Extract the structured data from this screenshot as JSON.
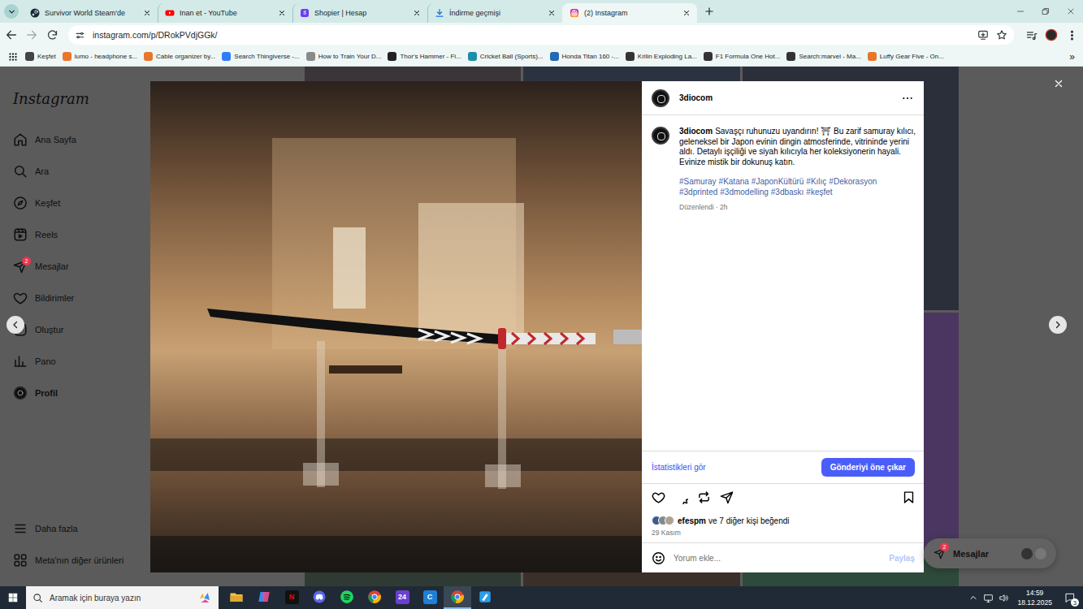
{
  "browser": {
    "tabs": [
      {
        "label": "Survivor World Steam'de",
        "selected": false,
        "kind": "steam"
      },
      {
        "label": "Inan et - YouTube",
        "selected": false,
        "kind": "youtube"
      },
      {
        "label": "Shopier | Hesap",
        "selected": false,
        "kind": "shopier"
      },
      {
        "label": "İndirme geçmişi",
        "selected": false,
        "kind": "download"
      },
      {
        "label": "(2) Instagram",
        "selected": true,
        "kind": "instagram"
      }
    ],
    "url": "instagram.com/p/DRokPVdjGGk/",
    "bookmarked": false,
    "bookmarks": [
      {
        "label": "Keşfet",
        "color": "#444444"
      },
      {
        "label": "lumo - headphone s...",
        "color": "#e8762b"
      },
      {
        "label": "Cable organizer by...",
        "color": "#e8762b"
      },
      {
        "label": "Search Thingiverse -...",
        "color": "#2f7df6"
      },
      {
        "label": "How to Train Your D...",
        "color": "#8a8a8a"
      },
      {
        "label": "Thor's Hammer - Fi...",
        "color": "#222222"
      },
      {
        "label": "Cricket Ball (Sports)...",
        "color": "#1c8fa8"
      },
      {
        "label": "Honda Titan 160 -...",
        "color": "#2469b3"
      },
      {
        "label": "Krilin Exploding La...",
        "color": "#333333"
      },
      {
        "label": "F1 Formula One Hot...",
        "color": "#333333"
      },
      {
        "label": "Search:marvel - Ma...",
        "color": "#333333"
      },
      {
        "label": "Luffy Gear Five - On...",
        "color": "#e8762b"
      }
    ],
    "bookmarks_more": "»"
  },
  "instagram": {
    "logo": "Instagram",
    "nav": [
      {
        "label": "Ana Sayfa",
        "kind": "home",
        "selected": false
      },
      {
        "label": "Ara",
        "kind": "search",
        "selected": false
      },
      {
        "label": "Keşfet",
        "kind": "explore",
        "selected": false
      },
      {
        "label": "Reels",
        "kind": "reels",
        "selected": false
      },
      {
        "label": "Mesajlar",
        "kind": "messages",
        "selected": false,
        "badge": "2"
      },
      {
        "label": "Bildirimler",
        "kind": "heart",
        "selected": false
      },
      {
        "label": "Oluştur",
        "kind": "create",
        "selected": false
      },
      {
        "label": "Pano",
        "kind": "dashboard",
        "selected": false
      },
      {
        "label": "Profil",
        "kind": "profile",
        "selected": true
      }
    ],
    "nav_bottom": [
      {
        "label": "Daha fazla",
        "kind": "menu"
      },
      {
        "label": "Meta'nın diğer ürünleri",
        "kind": "meta"
      }
    ]
  },
  "post": {
    "author": "3diocom",
    "caption_author": "3diocom",
    "caption": "Savaşçı ruhunuzu uyandırın! ⛩ Bu zarif samuray kılıcı, geleneksel bir Japon evinin dingin atmosferinde, vitrininde yerini aldı. Detaylı işçiliği ve siyah kılıcıyla her koleksiyonerin hayali. Evinize mistik bir dokunuş katın.",
    "hashtags": [
      "#Samuray",
      "#Katana",
      "#JaponKültürü",
      "#Kılıç",
      "#Dekorasyon",
      "#3dprinted",
      "#3dmodelling",
      "#3dbaskı",
      "#keşfet"
    ],
    "edited": "Düzenlendi · 2h",
    "insights": "İstatistikleri gör",
    "boost": "Gönderiyi öne çıkar",
    "liked": false,
    "saved": false,
    "likes_user": "efespm",
    "likes_rest": "ve 7 diğer kişi beğendi",
    "date": "29 Kasım",
    "comment_placeholder": "Yorum ekle...",
    "post_button": "Paylaş"
  },
  "messages_pill": {
    "label": "Mesajlar",
    "badge": "2"
  },
  "taskbar": {
    "search_placeholder": "Aramak için buraya yazın",
    "apps": [
      {
        "kind": "explorer",
        "selected": false
      },
      {
        "kind": "copilot",
        "selected": false
      },
      {
        "kind": "netflix",
        "glyph": "N",
        "selected": false
      },
      {
        "kind": "discord",
        "selected": false
      },
      {
        "kind": "spotify",
        "selected": false
      },
      {
        "kind": "chrome",
        "selected": false
      },
      {
        "kind": "app24",
        "glyph": "24",
        "selected": false
      },
      {
        "kind": "canva",
        "glyph": "C",
        "selected": false
      },
      {
        "kind": "chrome",
        "selected": true
      },
      {
        "kind": "paint",
        "selected": false
      }
    ],
    "time": "14:59",
    "date": "18.12.2025",
    "notifications": "3"
  }
}
